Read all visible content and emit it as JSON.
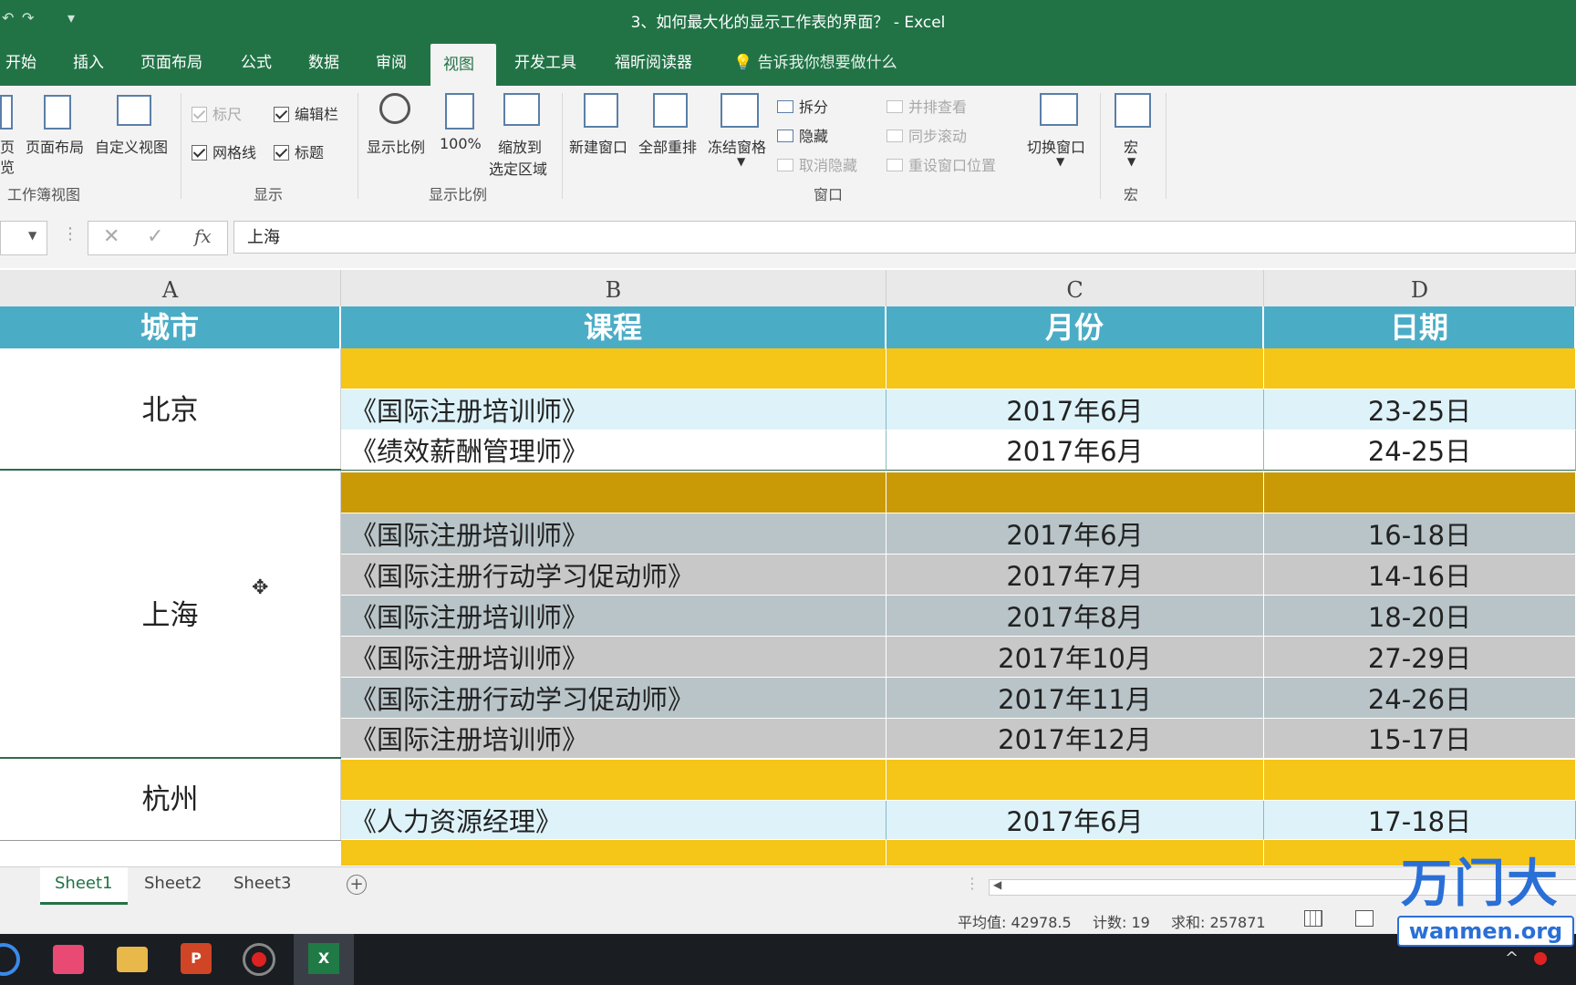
{
  "window": {
    "title": "3、如何最大化的显示工作表的界面？  -  Excel"
  },
  "tabs": [
    "开始",
    "插入",
    "页面布局",
    "公式",
    "数据",
    "审阅",
    "视图",
    "开发工具",
    "福昕阅读器"
  ],
  "tell_me": "告诉我你想要做什么",
  "ribbon": {
    "workbook_views": {
      "page_partial_1": "页",
      "page_partial_2": "览",
      "page_layout": "页面布局",
      "custom_view": "自定义视图",
      "group": "工作簿视图"
    },
    "show": {
      "ruler": "标尺",
      "formula_bar": "编辑栏",
      "gridlines": "网格线",
      "headings": "标题",
      "group": "显示"
    },
    "zoom": {
      "zoom": "显示比例",
      "hundred": "100%",
      "zoom_sel_1": "缩放到",
      "zoom_sel_2": "选定区域",
      "group": "显示比例"
    },
    "window": {
      "new_window": "新建窗口",
      "arrange_all": "全部重排",
      "freeze": "冻结窗格",
      "split": "拆分",
      "hide": "隐藏",
      "unhide": "取消隐藏",
      "side_by_side": "并排查看",
      "sync_scroll": "同步滚动",
      "reset_pos": "重设窗口位置",
      "switch": "切换窗口",
      "group": "窗口"
    },
    "macros": {
      "macro": "宏",
      "group": "宏"
    }
  },
  "formula_bar": {
    "value": "上海"
  },
  "columns": [
    "A",
    "B",
    "C",
    "D"
  ],
  "headers": {
    "city": "城市",
    "course": "课程",
    "month": "月份",
    "date": "日期"
  },
  "cities": {
    "beijing": "北京",
    "shanghai": "上海",
    "hangzhou": "杭州"
  },
  "rows": [
    {
      "course": "",
      "month": "",
      "date": ""
    },
    {
      "course": "《国际注册培训师》",
      "month": "2017年6月",
      "date": "23-25日"
    },
    {
      "course": "《绩效薪酬管理师》",
      "month": "2017年6月",
      "date": "24-25日"
    },
    {
      "course": "",
      "month": "",
      "date": ""
    },
    {
      "course": "《国际注册培训师》",
      "month": "2017年6月",
      "date": "16-18日"
    },
    {
      "course": "《国际注册行动学习促动师》",
      "month": "2017年7月",
      "date": "14-16日"
    },
    {
      "course": "《国际注册培训师》",
      "month": "2017年8月",
      "date": "18-20日"
    },
    {
      "course": "《国际注册培训师》",
      "month": "2017年10月",
      "date": "27-29日"
    },
    {
      "course": "《国际注册行动学习促动师》",
      "month": "2017年11月",
      "date": "24-26日"
    },
    {
      "course": "《国际注册培训师》",
      "month": "2017年12月",
      "date": "15-17日"
    },
    {
      "course": "",
      "month": "",
      "date": ""
    },
    {
      "course": "《人力资源经理》",
      "month": "2017年6月",
      "date": "17-18日"
    },
    {
      "course": "",
      "month": "",
      "date": ""
    }
  ],
  "colors": {
    "header": "#4bacc6",
    "yellow": "#f5c518",
    "dark_yellow": "#c99a06",
    "light_blue": "#ddf3f9",
    "gray": "#b8c4c8",
    "gray_alt": "#c8c8c8"
  },
  "sheets": [
    "Sheet1",
    "Sheet2",
    "Sheet3"
  ],
  "status": {
    "average": "平均值: 42978.5",
    "count": "计数: 19",
    "sum": "求和: 257871"
  },
  "watermark": {
    "brand": "万门大",
    "url": "wanmen.org"
  }
}
